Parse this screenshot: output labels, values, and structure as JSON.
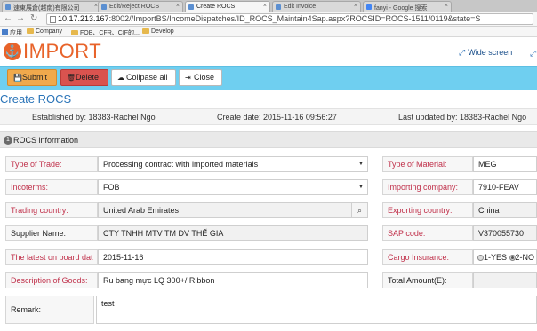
{
  "browser": {
    "tabs": [
      {
        "label": "速東展倉(越南)有限公司"
      },
      {
        "label": "Edit/Reject ROCS"
      },
      {
        "label": "Create ROCS"
      },
      {
        "label": "Edit Invoice"
      },
      {
        "label": "fanyi - Google 搜索"
      }
    ],
    "url_host": "10.17.213.167",
    "url_rest": ":8002//ImportBS/IncomeDispatches/ID_ROCS_Maintain4Sap.aspx?ROCSID=ROCS-1511/0119&state=S",
    "bookmarks": [
      {
        "label": "应用",
        "icon": "apps-grid-icon"
      },
      {
        "label": "Company",
        "icon": "folder-icon"
      },
      {
        "label": "FOB、CFR、CIF的...",
        "icon": "folder-icon"
      },
      {
        "label": "Develop",
        "icon": "folder-icon"
      }
    ]
  },
  "header": {
    "logo": "IMPORT",
    "logo_icon": "anchor-icon",
    "wide_screen_label": "Wide screen",
    "brand_color": "#e8632a"
  },
  "toolbar": {
    "submit_label": "Submit",
    "delete_label": "Delete",
    "collapse_label": "Collpase all",
    "close_label": "Close",
    "bg_color": "#6fcff0"
  },
  "page": {
    "title": "Create ROCS",
    "established_by": "Established by: 18383-Rachel Ngo",
    "create_date": "Create date: 2015-11-16 09:56:27",
    "last_updated_by": "Last updated by: 18383-Rachel Ngo"
  },
  "section": {
    "number": "1",
    "title": "ROCS information"
  },
  "form": {
    "type_of_trade": {
      "label": "Type of Trade:",
      "value": "Processing contract with imported materials"
    },
    "type_of_material": {
      "label": "Type of Material:",
      "value": "MEG"
    },
    "incoterms": {
      "label": "Incoterms:",
      "value": "FOB"
    },
    "importing_company": {
      "label": "Importing company:",
      "value": "7910-FEAV"
    },
    "trading_country": {
      "label": "Trading country:",
      "value": "United Arab Emirates"
    },
    "exporting_country": {
      "label": "Exporting country:",
      "value": "China"
    },
    "supplier_name": {
      "label": "Supplier Name:",
      "value": "CTY TNHH MTV TM DV THẾ GIA"
    },
    "sap_code": {
      "label": "SAP code:",
      "value": "V370055730"
    },
    "latest_on_board": {
      "label": "The latest on board dat",
      "value": "2015-11-16"
    },
    "cargo_insurance": {
      "label": "Cargo Insurance:",
      "yes_label": "1-YES",
      "no_label": "2-NO",
      "selected": "2-NO"
    },
    "description": {
      "label": "Description of Goods:",
      "value": "Ru bang mực LQ 300+/ Ribbon"
    },
    "total_amount": {
      "label": "Total Amount(E):",
      "value": ""
    },
    "remark": {
      "label": "Remark:",
      "value": "test"
    }
  }
}
